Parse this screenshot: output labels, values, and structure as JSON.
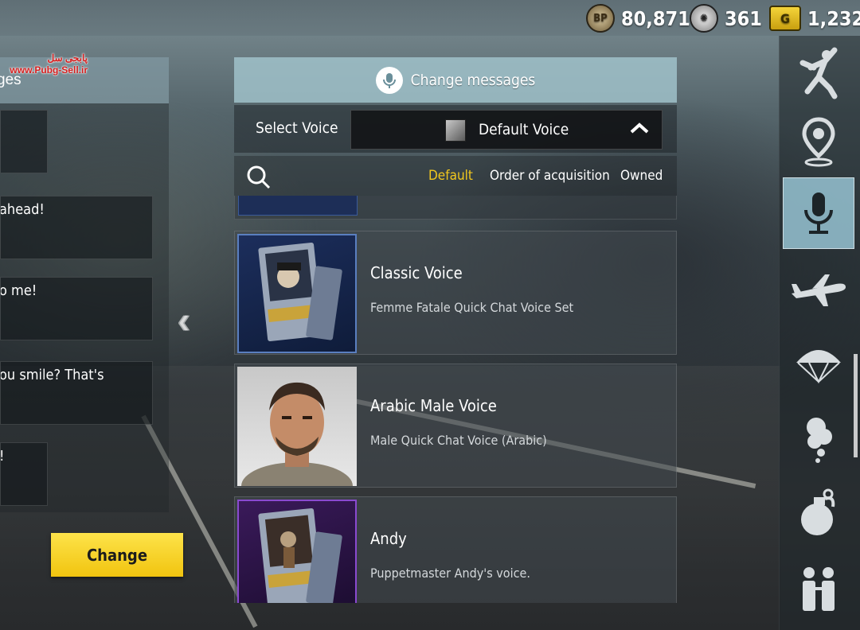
{
  "currencies": [
    {
      "icon": "bp-coin-icon",
      "label": "BP",
      "value": "80,871"
    },
    {
      "icon": "silver-fragment-icon",
      "value": "361"
    },
    {
      "icon": "g-coin-icon",
      "label": "G",
      "value": "1,232"
    }
  ],
  "watermark": {
    "line1": "پابجی سل",
    "line2": "www.Pubg-Sell.ir"
  },
  "left_panel": {
    "header_fragment": "ges",
    "messages": [
      {
        "text": ""
      },
      {
        "text": "ahead!"
      },
      {
        "text": "o me!"
      },
      {
        "text": "ou smile? That's"
      },
      {
        "text": "!"
      }
    ],
    "change_button": "Change"
  },
  "main": {
    "header_title": "Change messages",
    "select_label": "Select Voice",
    "dropdown_value": "Default Voice",
    "filter_tabs": [
      {
        "label": "Default",
        "active": true
      },
      {
        "label": "Order of acquisition",
        "active": false
      },
      {
        "label": "Owned",
        "active": false
      }
    ],
    "voices": [
      {
        "name": "Classic Voice",
        "description": "Femme Fatale Quick Chat Voice Set",
        "frame": "blue"
      },
      {
        "name": "Arabic Male Voice",
        "description": "Male Quick Chat Voice (Arabic)",
        "frame": "photo"
      },
      {
        "name": "Andy",
        "description": "Puppetmaster Andy's voice.",
        "frame": "purple"
      }
    ]
  },
  "right_nav": [
    {
      "icon": "emote-icon",
      "active": false
    },
    {
      "icon": "map-marker-icon",
      "active": false
    },
    {
      "icon": "microphone-icon",
      "active": true
    },
    {
      "icon": "plane-icon",
      "active": false
    },
    {
      "icon": "parachute-icon",
      "active": false
    },
    {
      "icon": "smoke-trail-icon",
      "active": false
    },
    {
      "icon": "grenade-icon",
      "active": false
    },
    {
      "icon": "team-icon",
      "active": false
    }
  ],
  "colors": {
    "accent_yellow": "#f3c81d",
    "active_nav": "#96c3d2",
    "button_yellow": "#f1c40f"
  }
}
